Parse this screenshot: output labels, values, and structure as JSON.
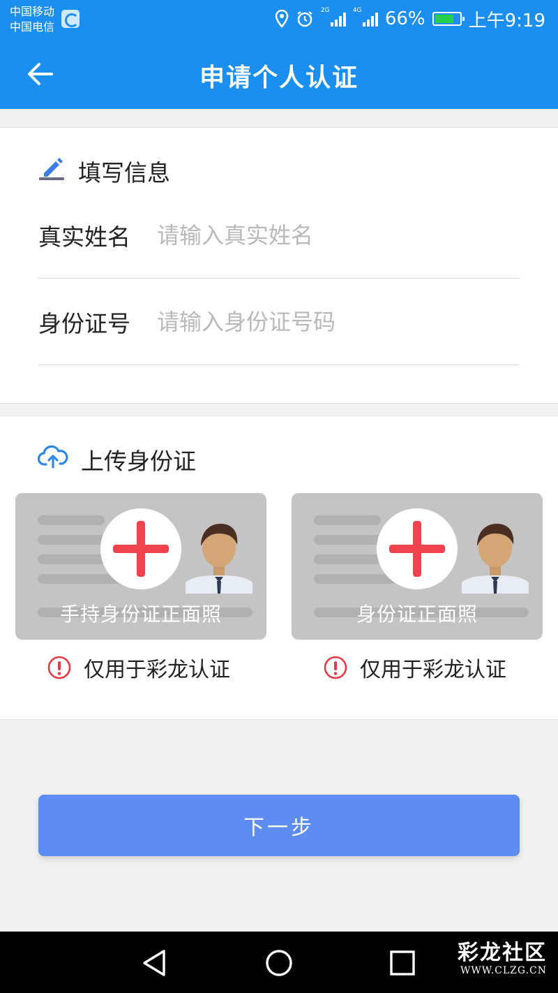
{
  "status_bar": {
    "carrier_1": "中国移动",
    "carrier_2": "中国电信",
    "network_1": "2G",
    "network_2": "4G",
    "battery": "66%",
    "time": "上午9:19"
  },
  "header": {
    "title": "申请个人认证",
    "back_icon": "arrow-left-icon",
    "background": "#1b8ff0"
  },
  "info_section": {
    "heading": "填写信息",
    "icon": "pencil-icon",
    "fields": [
      {
        "label": "真实姓名",
        "placeholder": "请输入真实姓名",
        "value": ""
      },
      {
        "label": "身份证号",
        "placeholder": "请输入身份证号码",
        "value": ""
      }
    ]
  },
  "upload_section": {
    "heading": "上传身份证",
    "icon": "cloud-upload-icon",
    "cards": [
      {
        "caption": "手持身份证正面照",
        "notice": "仅用于彩龙认证"
      },
      {
        "caption": "身份证正面照",
        "notice": "仅用于彩龙认证"
      }
    ]
  },
  "actions": {
    "next_label": "下一步",
    "button_color": "#5d8df0"
  },
  "watermark": {
    "title": "彩龙社区",
    "url": "WWW.CLZG.CN"
  }
}
